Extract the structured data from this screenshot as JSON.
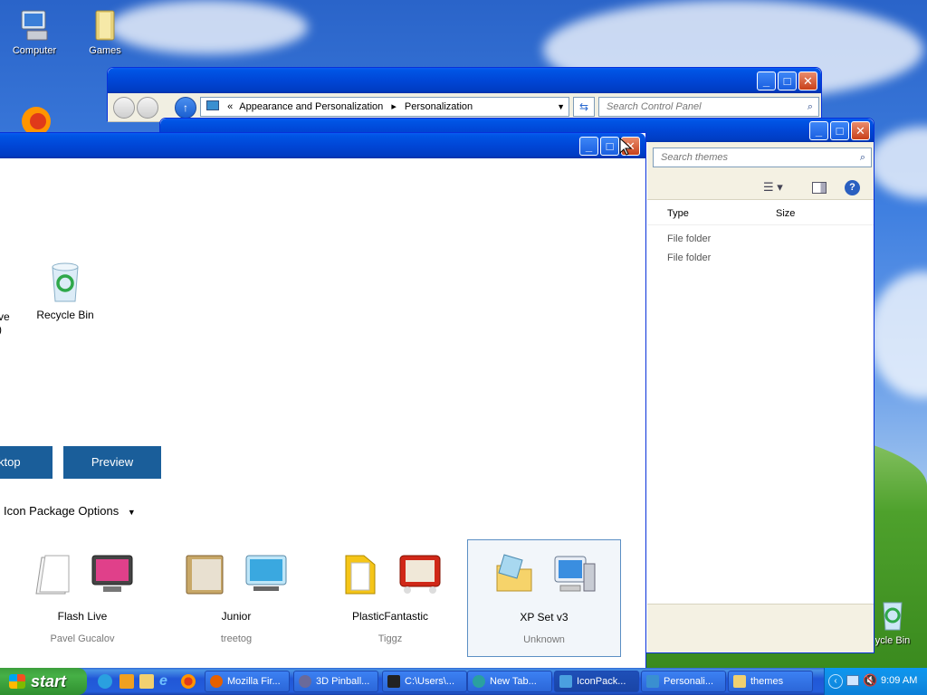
{
  "desktop": {
    "icons": [
      {
        "label": "Computer",
        "icon": "computer-icon"
      },
      {
        "label": "Games",
        "icon": "games-folder-icon"
      },
      {
        "label": "Firefox",
        "icon": "firefox-icon"
      },
      {
        "label": "ycle Bin",
        "icon": "recycle-bin-icon"
      }
    ]
  },
  "control_panel": {
    "breadcrumb_prefix": "«",
    "breadcrumb": [
      "Appearance and Personalization",
      "Personalization"
    ],
    "search_placeholder": "Search Control Panel"
  },
  "themes_window": {
    "search_placeholder": "Search themes",
    "columns": [
      "Type",
      "Size"
    ],
    "rows": [
      {
        "type": "File folder",
        "size": ""
      },
      {
        "type": "File folder",
        "size": ""
      }
    ]
  },
  "iconpack_window": {
    "partial_label_left": "ve",
    "partial_label_left2": ")",
    "recycle_label": "Recycle Bin",
    "desktop_button": "ktop",
    "preview_button": "Preview",
    "options_label": "Icon Package Options",
    "packages": [
      {
        "name": "Flash Live",
        "author": "Pavel Gucalov"
      },
      {
        "name": "Junior",
        "author": "treetog"
      },
      {
        "name": "PlasticFantastic",
        "author": "Tiggz"
      },
      {
        "name": "XP Set v3",
        "author": "Unknown"
      }
    ]
  },
  "taskbar": {
    "start_label": "start",
    "tasks": [
      {
        "label": "Mozilla Fir...",
        "icon": "firefox-icon",
        "color": "#e66000"
      },
      {
        "label": "3D Pinball...",
        "icon": "pinball-icon",
        "color": "#6a6a9a"
      },
      {
        "label": "C:\\Users\\...",
        "icon": "sevenzip-icon",
        "color": "#222222"
      },
      {
        "label": "New Tab...",
        "icon": "browser-icon",
        "color": "#2aa0a0"
      },
      {
        "label": "IconPack...",
        "icon": "iconpack-icon",
        "color": "#4aa0e0"
      },
      {
        "label": "Personali...",
        "icon": "monitor-icon",
        "color": "#3a8fd0"
      },
      {
        "label": "themes",
        "icon": "folder-icon",
        "color": "#f0d070"
      }
    ],
    "clock": "9:09 AM"
  }
}
